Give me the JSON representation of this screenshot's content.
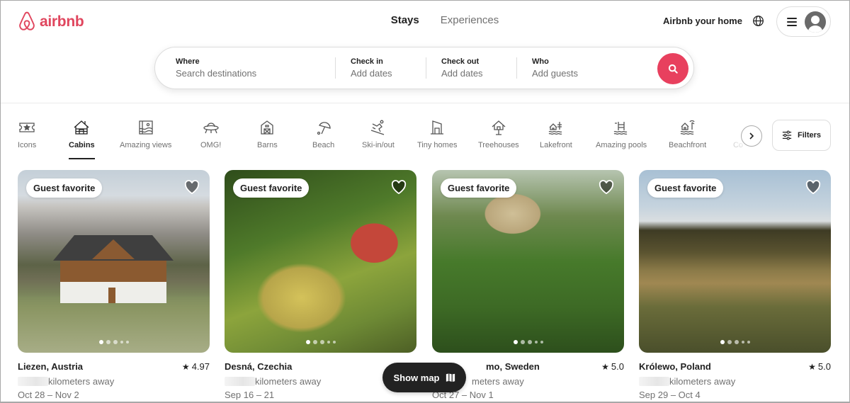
{
  "header": {
    "logo_text": "airbnb",
    "brand_color": "#e0465e",
    "nav_tabs": [
      {
        "label": "Stays",
        "active": true
      },
      {
        "label": "Experiences",
        "active": false
      }
    ],
    "host_link": "Airbnb your home",
    "globe_icon": "globe-icon",
    "menu_icon": "hamburger-icon",
    "avatar_icon": "user-avatar-icon"
  },
  "search": {
    "where": {
      "label": "Where",
      "placeholder": "Search destinations"
    },
    "check_in": {
      "label": "Check in",
      "placeholder": "Add dates"
    },
    "check_out": {
      "label": "Check out",
      "placeholder": "Add dates"
    },
    "who": {
      "label": "Who",
      "placeholder": "Add guests"
    },
    "button_icon": "search-icon",
    "button_color": "#e8405e"
  },
  "categories": {
    "items": [
      {
        "label": "Icons",
        "icon": "ticket-star-icon"
      },
      {
        "label": "Cabins",
        "icon": "cabin-icon",
        "active": true
      },
      {
        "label": "Amazing views",
        "icon": "amazing-views-icon"
      },
      {
        "label": "OMG!",
        "icon": "ufo-icon"
      },
      {
        "label": "Barns",
        "icon": "barn-icon"
      },
      {
        "label": "Beach",
        "icon": "beach-umbrella-icon"
      },
      {
        "label": "Ski-in/out",
        "icon": "skier-icon"
      },
      {
        "label": "Tiny homes",
        "icon": "tiny-home-icon"
      },
      {
        "label": "Treehouses",
        "icon": "treehouse-icon"
      },
      {
        "label": "Lakefront",
        "icon": "lakefront-icon"
      },
      {
        "label": "Amazing pools",
        "icon": "pool-icon"
      },
      {
        "label": "Beachfront",
        "icon": "beachfront-icon"
      },
      {
        "label": "Co",
        "icon": "truncated-category-icon"
      }
    ],
    "next_icon": "chevron-right-icon",
    "filters_label": "Filters",
    "filters_icon": "sliders-icon"
  },
  "listings": [
    {
      "badge": "Guest favorite",
      "location": "Liezen, Austria",
      "rating": "4.97",
      "distance": "kilometers away",
      "dates": "Oct 28 – Nov 2",
      "photo_index": 0,
      "photo_count": 5
    },
    {
      "badge": "Guest favorite",
      "location": "Desná, Czechia",
      "rating": "",
      "distance": "kilometers away",
      "dates": "Sep 16 – 21",
      "photo_index": 0,
      "photo_count": 5
    },
    {
      "badge": "Guest favorite",
      "location": "mo, Sweden",
      "rating": "5.0",
      "distance": "meters away",
      "dates": "Oct 27 – Nov 1",
      "photo_index": 0,
      "photo_count": 5
    },
    {
      "badge": "Guest favorite",
      "location": "Królewo, Poland",
      "rating": "5.0",
      "distance": "kilometers away",
      "dates": "Sep 29 – Oct 4",
      "photo_index": 0,
      "photo_count": 5
    }
  ],
  "show_map": {
    "label": "Show map",
    "icon": "map-icon"
  }
}
